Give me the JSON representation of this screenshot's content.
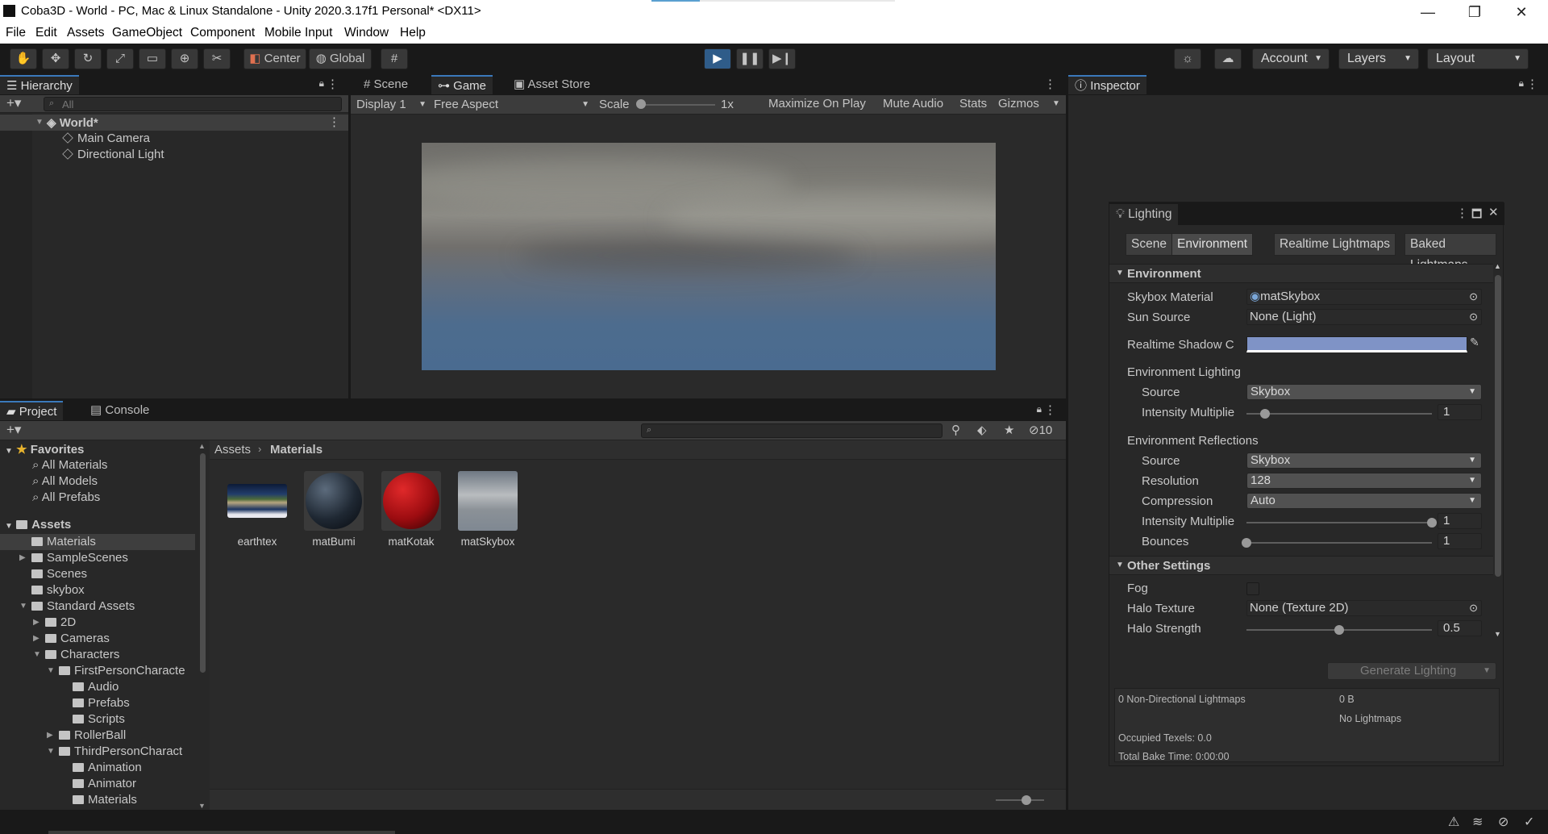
{
  "window": {
    "title": "Coba3D - World - PC, Mac & Linux Standalone - Unity 2020.3.17f1 Personal* <DX11>",
    "controls": {
      "minimize": "—",
      "maximize": "❐",
      "close": "✕"
    }
  },
  "menu": [
    "File",
    "Edit",
    "Assets",
    "GameObject",
    "Component",
    "Mobile Input",
    "Window",
    "Help"
  ],
  "toolbar": {
    "pivot": "Center",
    "space": "Global",
    "account": "Account",
    "layers": "Layers",
    "layout": "Layout",
    "playing": true
  },
  "hierarchy": {
    "tab": "Hierarchy",
    "search_placeholder": "All",
    "scene": "World*",
    "items": [
      "Main Camera",
      "Directional Light"
    ]
  },
  "game_view": {
    "tabs": [
      "Scene",
      "Game",
      "Asset Store"
    ],
    "display": "Display 1",
    "aspect": "Free Aspect",
    "scale_label": "Scale",
    "scale_value": "1x",
    "scale_level": 0,
    "buttons": [
      "Maximize On Play",
      "Mute Audio",
      "Stats",
      "Gizmos"
    ]
  },
  "project": {
    "tabs": [
      "Project",
      "Console"
    ],
    "hidden_count": "10",
    "breadcrumb": [
      "Assets",
      "Materials"
    ],
    "favorites_label": "Favorites",
    "favorites": [
      "All Materials",
      "All Models",
      "All Prefabs"
    ],
    "assets_label": "Assets",
    "tree": [
      {
        "label": "Materials",
        "indent": 1,
        "arrow": "",
        "selected": true
      },
      {
        "label": "SampleScenes",
        "indent": 1,
        "arrow": "▶"
      },
      {
        "label": "Scenes",
        "indent": 1,
        "arrow": ""
      },
      {
        "label": "skybox",
        "indent": 1,
        "arrow": ""
      },
      {
        "label": "Standard Assets",
        "indent": 1,
        "arrow": "▼"
      },
      {
        "label": "2D",
        "indent": 2,
        "arrow": "▶"
      },
      {
        "label": "Cameras",
        "indent": 2,
        "arrow": "▶"
      },
      {
        "label": "Characters",
        "indent": 2,
        "arrow": "▼"
      },
      {
        "label": "FirstPersonCharacte",
        "indent": 3,
        "arrow": "▼"
      },
      {
        "label": "Audio",
        "indent": 4,
        "arrow": ""
      },
      {
        "label": "Prefabs",
        "indent": 4,
        "arrow": ""
      },
      {
        "label": "Scripts",
        "indent": 4,
        "arrow": ""
      },
      {
        "label": "RollerBall",
        "indent": 3,
        "arrow": "▶"
      },
      {
        "label": "ThirdPersonCharact",
        "indent": 3,
        "arrow": "▼"
      },
      {
        "label": "Animation",
        "indent": 4,
        "arrow": ""
      },
      {
        "label": "Animator",
        "indent": 4,
        "arrow": ""
      },
      {
        "label": "Materials",
        "indent": 4,
        "arrow": ""
      }
    ],
    "assets": [
      {
        "name": "earthtex",
        "kind": "texture"
      },
      {
        "name": "matBumi",
        "kind": "sphere-dark"
      },
      {
        "name": "matKotak",
        "kind": "sphere-red"
      },
      {
        "name": "matSkybox",
        "kind": "sky"
      }
    ]
  },
  "inspector": {
    "tab": "Inspector"
  },
  "lighting": {
    "title": "Lighting",
    "tabs": [
      "Scene",
      "Environment",
      "Realtime Lightmaps",
      "Baked Lightmaps"
    ],
    "active_tab": "Environment",
    "environment_header": "Environment",
    "skybox_material_label": "Skybox Material",
    "skybox_material": "matSkybox",
    "sun_source_label": "Sun Source",
    "sun_source": "None (Light)",
    "shadow_color_label": "Realtime Shadow C",
    "shadow_color": "#7f93c6",
    "env_lighting_header": "Environment Lighting",
    "source_label": "Source",
    "env_source": "Skybox",
    "intensity_label": "Intensity Multiplie",
    "env_intensity": "1",
    "env_intensity_level": 0.1,
    "env_reflections_header": "Environment Reflections",
    "refl_source": "Skybox",
    "resolution_label": "Resolution",
    "resolution": "128",
    "compression_label": "Compression",
    "compression": "Auto",
    "refl_intensity": "1",
    "refl_intensity_level": 1.0,
    "bounces_label": "Bounces",
    "bounces": "1",
    "bounces_level": 0.0,
    "other_header": "Other Settings",
    "fog_label": "Fog",
    "halo_texture_label": "Halo Texture",
    "halo_texture": "None (Texture 2D)",
    "halo_strength_label": "Halo Strength",
    "halo_strength": "0.5",
    "halo_strength_level": 0.5,
    "generate_button": "Generate Lighting",
    "stats": {
      "lightmaps": "0 Non-Directional Lightmaps",
      "size": "0 B",
      "no_lightmaps": "No Lightmaps",
      "occupied": "Occupied Texels: 0.0",
      "bake_time": "Total Bake Time: 0:00:00"
    }
  }
}
